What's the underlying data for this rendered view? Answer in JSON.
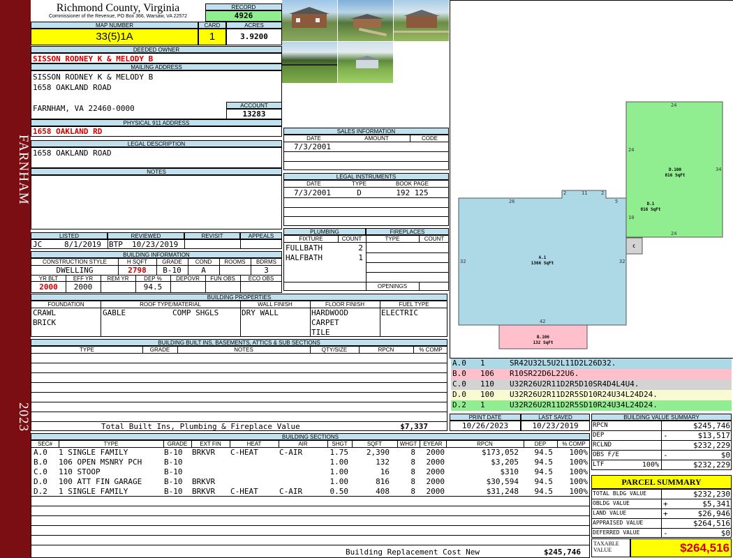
{
  "sidebar": {
    "city": "FARNHAM",
    "year": "2023"
  },
  "header": {
    "county": "Richmond County, Virginia",
    "commissioner": "Commissioner of the Revenue, PO Box 366, Warsaw, VA 22572",
    "record_label": "RECORD",
    "record": "4926",
    "map_label": "MAP NUMBER",
    "map": "33(5)1A",
    "card_label": "CARD",
    "card": "1",
    "acres_label": "ACRES",
    "acres": "3.9200"
  },
  "owner": {
    "deeded_label": "DEEDED OWNER",
    "deeded": "SISSON RODNEY K & MELODY B",
    "mailing_label": "MAILING ADDRESS",
    "mail1": "SISSON RODNEY K & MELODY B",
    "mail2": "1658 OAKLAND ROAD",
    "mail3": "FARNHAM, VA 22460-0000",
    "account_label": "ACCOUNT",
    "account": "13283",
    "phys_label": "PHYSICAL 911 ADDRESS",
    "phys": "1658 OAKLAND RD",
    "legal_label": "LEGAL DESCRIPTION",
    "legal": "1658 OAKLAND ROAD",
    "notes_label": "NOTES"
  },
  "review": {
    "listed_label": "LISTED",
    "reviewed_label": "REVIEWED",
    "revisit_label": "REVISIT",
    "appeals_label": "APPEALS",
    "listed_by": "JC",
    "listed_date": "8/1/2019",
    "reviewed_by": "BTP",
    "reviewed_date": "10/23/2019"
  },
  "building_info": {
    "label": "BUILDING INFORMATION",
    "h": [
      "CONSTRUCTION STYLE",
      "H SQFT",
      "GRADE",
      "COND",
      "ROOMS",
      "BDRMS"
    ],
    "style": "DWELLING",
    "hsqft": "2798",
    "grade": "B-10",
    "cond": "A",
    "rooms": "",
    "bdrms": "3",
    "h2": [
      "YR BLT",
      "EFF YR",
      "REM YR",
      "DEP %",
      "DEPOVR",
      "FUN OBS",
      "ECO OBS"
    ],
    "yrblt": "2000",
    "effyr": "2000",
    "remyr": "",
    "dep": "94.5"
  },
  "sales": {
    "label": "SALES INFORMATION",
    "h_date": "DATE",
    "h_amount": "AMOUNT",
    "h_code": "CODE",
    "date": "7/3/2001"
  },
  "legal_instr": {
    "label": "LEGAL INSTRUMENTS",
    "h_date": "DATE",
    "h_type": "TYPE",
    "h_book": "BOOK PAGE",
    "date": "7/3/2001",
    "type": "D",
    "book": "192 125"
  },
  "plumbing": {
    "label": "PLUMBING",
    "h_fixture": "FIXTURE",
    "h_count": "COUNT",
    "rows": [
      {
        "fixture": "FULLBATH",
        "count": "2"
      },
      {
        "fixture": "HALFBATH",
        "count": "1"
      }
    ]
  },
  "fireplaces": {
    "label": "FIREPLACES",
    "h_type": "TYPE",
    "h_count": "COUNT",
    "openings": "OPENINGS"
  },
  "properties": {
    "label": "BUILDING PROPERTIES",
    "h": [
      "FOUNDATION",
      "ROOF TYPE/MATERIAL",
      "WALL FINISH",
      "FLOOR FINISH",
      "FUEL TYPE"
    ],
    "foundation1": "CRAWL",
    "foundation2": "BRICK",
    "roof_type": "GABLE",
    "roof_mat": "COMP SHGLS",
    "wall": "DRY WALL",
    "floor1": "HARDWOOD",
    "floor2": "CARPET",
    "floor3": "TILE",
    "fuel": "ELECTRIC"
  },
  "builtins": {
    "label": "BUILDING BUILT INS, BASEMENTS, ATTICS & SUB SECTIONS",
    "h": [
      "TYPE",
      "GRADE",
      "NOTES",
      "QTY/SIZE",
      "RPCN",
      "% COMP"
    ],
    "total_label": "Total Built Ins, Plumbing & Fireplace Value",
    "total": "$7,337"
  },
  "sections": {
    "label": "BUILDING SECTIONS",
    "h": [
      "SEC#",
      "TYPE",
      "GRADE",
      "EXT FIN",
      "HEAT",
      "AIR",
      "SHGT",
      "SQFT",
      "WHGT",
      "EYEAR",
      "RPCN",
      "DEP",
      "% COMP"
    ],
    "rows": [
      {
        "sec": "A.0",
        "type": "1 SINGLE FAMILY",
        "grade": "B-10",
        "ext": "BRKVR",
        "heat": "C-HEAT",
        "air": "C-AIR",
        "shgt": "1.75",
        "sqft": "2,390",
        "whgt": "8",
        "eyear": "2000",
        "rpcn": "$173,052",
        "dep": "94.5",
        "comp": "100%"
      },
      {
        "sec": "B.0",
        "type": "106 OPEN MSNRY PCH",
        "grade": "B-10",
        "ext": "",
        "heat": "",
        "air": "",
        "shgt": "1.00",
        "sqft": "132",
        "whgt": "8",
        "eyear": "2000",
        "rpcn": "$3,205",
        "dep": "94.5",
        "comp": "100%"
      },
      {
        "sec": "C.0",
        "type": "110 STOOP",
        "grade": "B-10",
        "ext": "",
        "heat": "",
        "air": "",
        "shgt": "1.00",
        "sqft": "16",
        "whgt": "8",
        "eyear": "2000",
        "rpcn": "$310",
        "dep": "94.5",
        "comp": "100%"
      },
      {
        "sec": "D.0",
        "type": "100 ATT FIN GARAGE",
        "grade": "B-10",
        "ext": "BRKVR",
        "heat": "",
        "air": "",
        "shgt": "1.00",
        "sqft": "816",
        "whgt": "8",
        "eyear": "2000",
        "rpcn": "$30,594",
        "dep": "94.5",
        "comp": "100%"
      },
      {
        "sec": "D.2",
        "type": "1 SINGLE FAMILY",
        "grade": "B-10",
        "ext": "BRKVR",
        "heat": "C-HEAT",
        "air": "C-AIR",
        "shgt": "0.50",
        "sqft": "408",
        "whgt": "8",
        "eyear": "2000",
        "rpcn": "$31,248",
        "dep": "94.5",
        "comp": "100%"
      }
    ],
    "brcn_label": "Building Replacement Cost New",
    "brcn": "$245,746"
  },
  "sketch": {
    "areas": [
      {
        "label": "A.1",
        "sqft": "1366 SqFt"
      },
      {
        "label": "B.106",
        "sqft": "132 SqFt"
      },
      {
        "label": "D.100",
        "sqft": "816 SqFt"
      },
      {
        "label": "D.1",
        "sqft": "816 SqFt"
      },
      {
        "label": "C",
        "sqft": ""
      }
    ],
    "dims": [
      "26",
      "2",
      "11",
      "2",
      "5",
      "32",
      "32",
      "42",
      "24",
      "24",
      "34",
      "24",
      "10"
    ],
    "legend": [
      {
        "code": "A.0",
        "num": "1",
        "path": "SR42U32L5U2L11D2L26D32.",
        "color": "#add8e6"
      },
      {
        "code": "B.0",
        "num": "106",
        "path": "R10SR22D6L22U6.",
        "color": "#ffc0cb"
      },
      {
        "code": "C.0",
        "num": "110",
        "path": "U32R26U2R11D2R5D10SR4D4L4U4.",
        "color": "#d3d3d3"
      },
      {
        "code": "D.0",
        "num": "100",
        "path": "U32R26U2R11D2R5SD10R24U34L24D24.",
        "color": "#fafad2"
      },
      {
        "code": "D.2",
        "num": "1",
        "path": "U32R26U2R11D2R5SD10R24U34L24D24.",
        "color": "#90ee90"
      }
    ]
  },
  "dates": {
    "print_label": "PRINT DATE",
    "print": "10/26/2023",
    "saved_label": "LAST SAVED",
    "saved": "10/23/2019"
  },
  "bvs": {
    "label": "BUILDING VALUE SUMMARY",
    "rows": [
      {
        "k": "RPCN",
        "s": "",
        "v": "$245,746"
      },
      {
        "k": "DEP",
        "s": "-",
        "v": "$13,517"
      },
      {
        "k": "RCLND",
        "s": "",
        "v": "$232,229"
      },
      {
        "k": "OBS F/E",
        "s": "-",
        "v": "$0"
      },
      {
        "k": "LTF",
        "p": "100%",
        "s": "",
        "v": "$232,229"
      }
    ]
  },
  "parcel": {
    "label": "PARCEL SUMMARY",
    "rows": [
      {
        "k": "TOTAL BLDG VALUE",
        "s": "",
        "v": "$232,230"
      },
      {
        "k": "OBLDG VALUE",
        "s": "+",
        "v": "$5,341"
      },
      {
        "k": "LAND VALUE",
        "s": "+",
        "v": "$26,946"
      },
      {
        "k": "APPRAISED VALUE",
        "s": "",
        "v": "$264,516"
      },
      {
        "k": "DEFERRED VALUE",
        "s": "-",
        "v": "$0"
      }
    ],
    "taxable_label": "TAXABLE VALUE",
    "taxable": "$264,516"
  },
  "colors": {
    "sidebar": "#7a0e12",
    "header_fill": "#bfe0ec",
    "yellow": "#ffff00",
    "green": "#90ee90",
    "red": "#cc0000"
  }
}
